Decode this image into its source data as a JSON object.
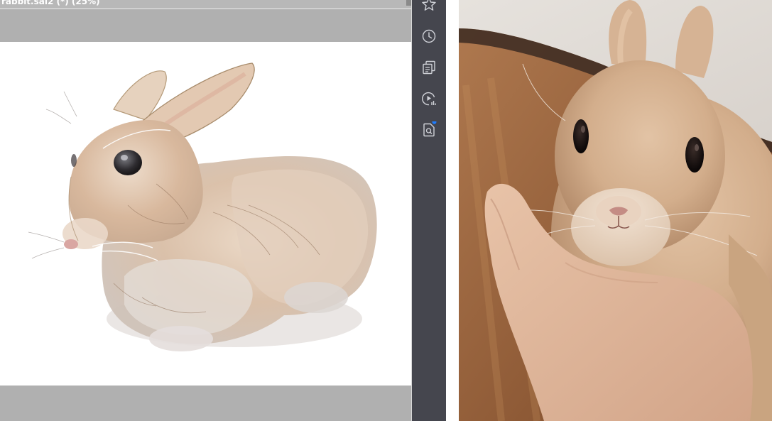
{
  "document": {
    "title": "rabbit.sai2 (*) (25%)"
  },
  "colors": {
    "workspace": "#b0b0b0",
    "paper": "#ffffff",
    "toolbar": "#45464e",
    "icon": "#d0d2d8",
    "notification_dot": "#1e7cff"
  },
  "toolbar": {
    "icons": [
      "star-icon",
      "clock-icon",
      "documents-icon",
      "video-stats-icon",
      "search-document-icon"
    ],
    "notification_on": "search-document-icon"
  },
  "artwork": {
    "subject": "watercolor rabbit illustration"
  },
  "reference_photo": {
    "subject": "photo of rabbit resting chin on hand"
  }
}
